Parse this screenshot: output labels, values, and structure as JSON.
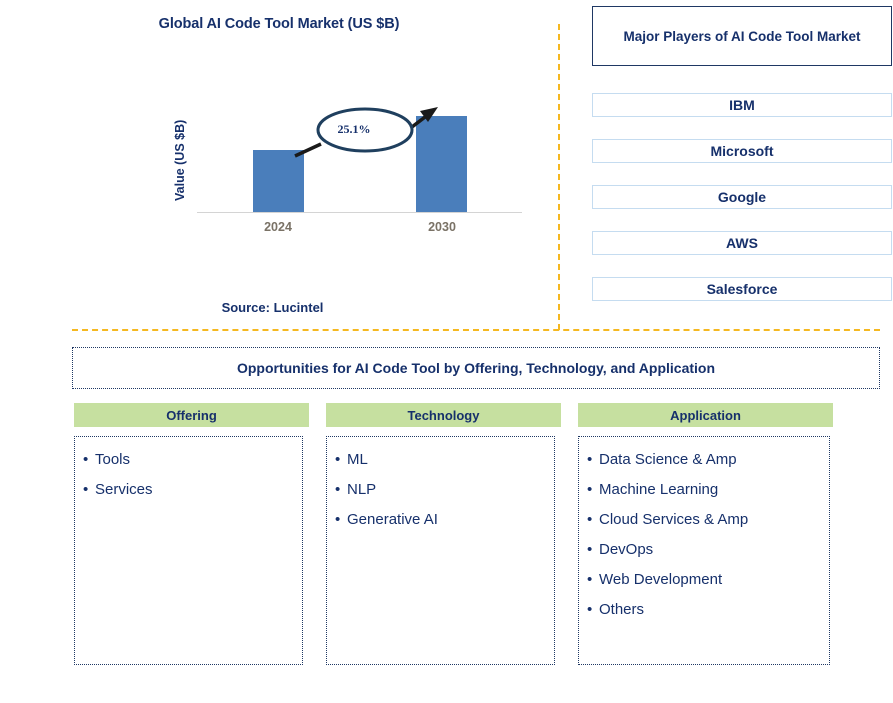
{
  "chart_panel": {
    "title": "Global AI Code Tool Market (US $B)",
    "source": "Source: Lucintel",
    "cagr_label": "25.1%"
  },
  "chart_data": {
    "type": "bar",
    "title": "Global AI Code Tool Market (US $B)",
    "xlabel": "",
    "ylabel": "Value (US $B)",
    "categories": [
      "2024",
      "2030"
    ],
    "values": [
      62,
      96
    ],
    "value_unit": "relative bar height (px); absolute values not labeled",
    "annotations": [
      {
        "text": "25.1%",
        "type": "cagr-callout",
        "from": "2024",
        "to": "2030"
      }
    ],
    "grid": false,
    "legend": false,
    "bar_color": "#4a7ebb",
    "axis_tick_color": "#7a7266"
  },
  "players": {
    "title": "Major Players of AI Code Tool Market",
    "items": [
      {
        "label": "IBM"
      },
      {
        "label": "Microsoft"
      },
      {
        "label": "Google"
      },
      {
        "label": "AWS"
      },
      {
        "label": "Salesforce"
      }
    ]
  },
  "opportunities": {
    "banner": "Opportunities for AI Code Tool by Offering, Technology, and Application",
    "columns": [
      {
        "header": "Offering",
        "items": [
          "Tools",
          "Services"
        ]
      },
      {
        "header": "Technology",
        "items": [
          "ML",
          "NLP",
          "Generative AI"
        ]
      },
      {
        "header": "Application",
        "items": [
          "Data Science & Amp",
          "Machine Learning",
          "Cloud Services & Amp",
          "DevOps",
          "Web Development",
          "Others"
        ]
      }
    ]
  },
  "colors": {
    "navy": "#16306b",
    "bar": "#4a7ebb",
    "divider_orange": "#f5b820",
    "header_green": "#c6e0a0",
    "player_border": "#c5dcf0"
  },
  "bullet_glyph": "•"
}
